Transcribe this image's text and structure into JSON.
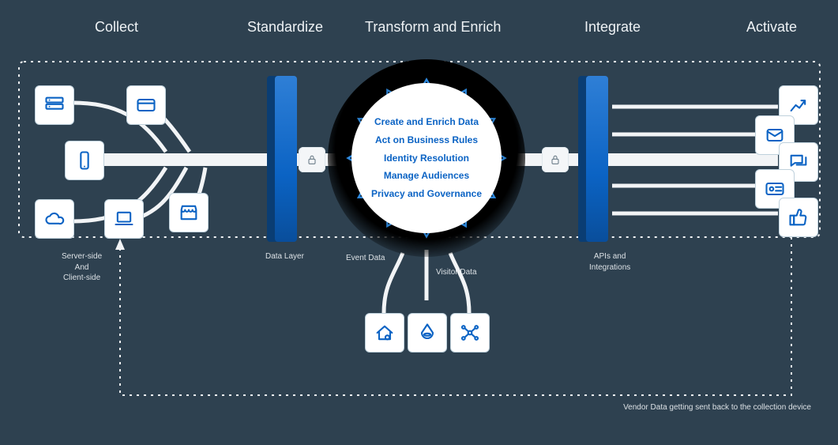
{
  "stages": {
    "collect": "Collect",
    "standardize": "Standardize",
    "transform": "Transform and Enrich",
    "integrate": "Integrate",
    "activate": "Activate"
  },
  "labels": {
    "collect_sub": "Server-side\nAnd\nClient-side",
    "standardize_sub": "Data Layer",
    "event_data": "Event Data",
    "visitor_data": "Visitor Data",
    "integrate_sub": "APIs and\nIntegrations",
    "footer": "Vendor Data getting sent back to the collection device"
  },
  "core": {
    "l1": "Create and Enrich Data",
    "l2": "Act on Business Rules",
    "l3": "Identity Resolution",
    "l4": "Manage Audiences",
    "l5": "Privacy and Governance"
  }
}
